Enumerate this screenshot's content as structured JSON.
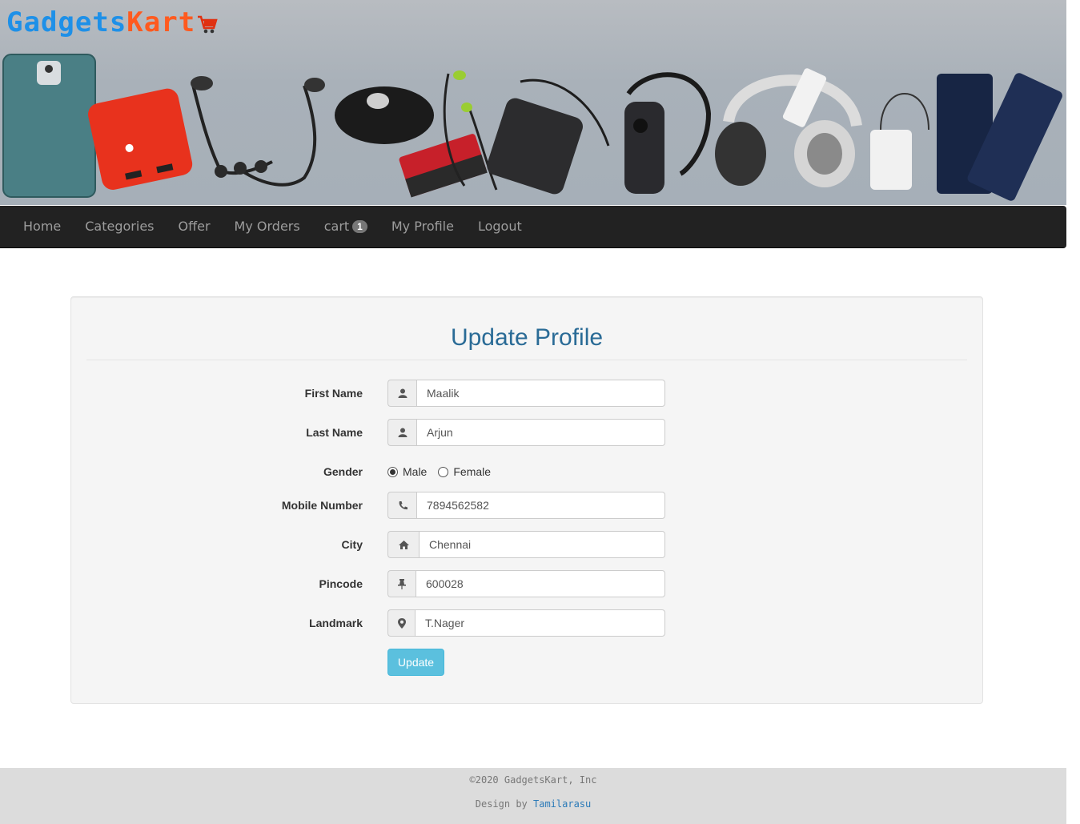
{
  "brand": {
    "part1": "Gadgets",
    "part2": "Kart"
  },
  "nav": {
    "home": "Home",
    "categories": "Categories",
    "offer": "Offer",
    "orders": "My Orders",
    "cart": "cart",
    "cart_count": "1",
    "profile": "My Profile",
    "logout": "Logout"
  },
  "form": {
    "title": "Update Profile",
    "first_name": {
      "label": "First Name",
      "value": "Maalik",
      "icon": "user-icon"
    },
    "last_name": {
      "label": "Last Name",
      "value": "Arjun",
      "icon": "user-icon"
    },
    "gender": {
      "label": "Gender",
      "options": [
        "Male",
        "Female"
      ],
      "selected": "Male"
    },
    "mobile": {
      "label": "Mobile Number",
      "value": "7894562582",
      "icon": "phone-icon"
    },
    "city": {
      "label": "City",
      "value": "Chennai",
      "icon": "home-icon"
    },
    "pincode": {
      "label": "Pincode",
      "value": "600028",
      "icon": "pushpin-icon"
    },
    "landmark": {
      "label": "Landmark",
      "value": "T.Nager",
      "icon": "map-marker-icon"
    },
    "submit": "Update"
  },
  "footer": {
    "copyright": "©2020 GadgetsKart, Inc",
    "design_prefix": "Design by ",
    "designer": "Tamilarasu"
  },
  "colors": {
    "brand_blue": "#1e90e8",
    "brand_orange": "#ff5a1f",
    "navbar": "#222222",
    "title_blue": "#2a6b96",
    "button": "#5bc0de"
  }
}
